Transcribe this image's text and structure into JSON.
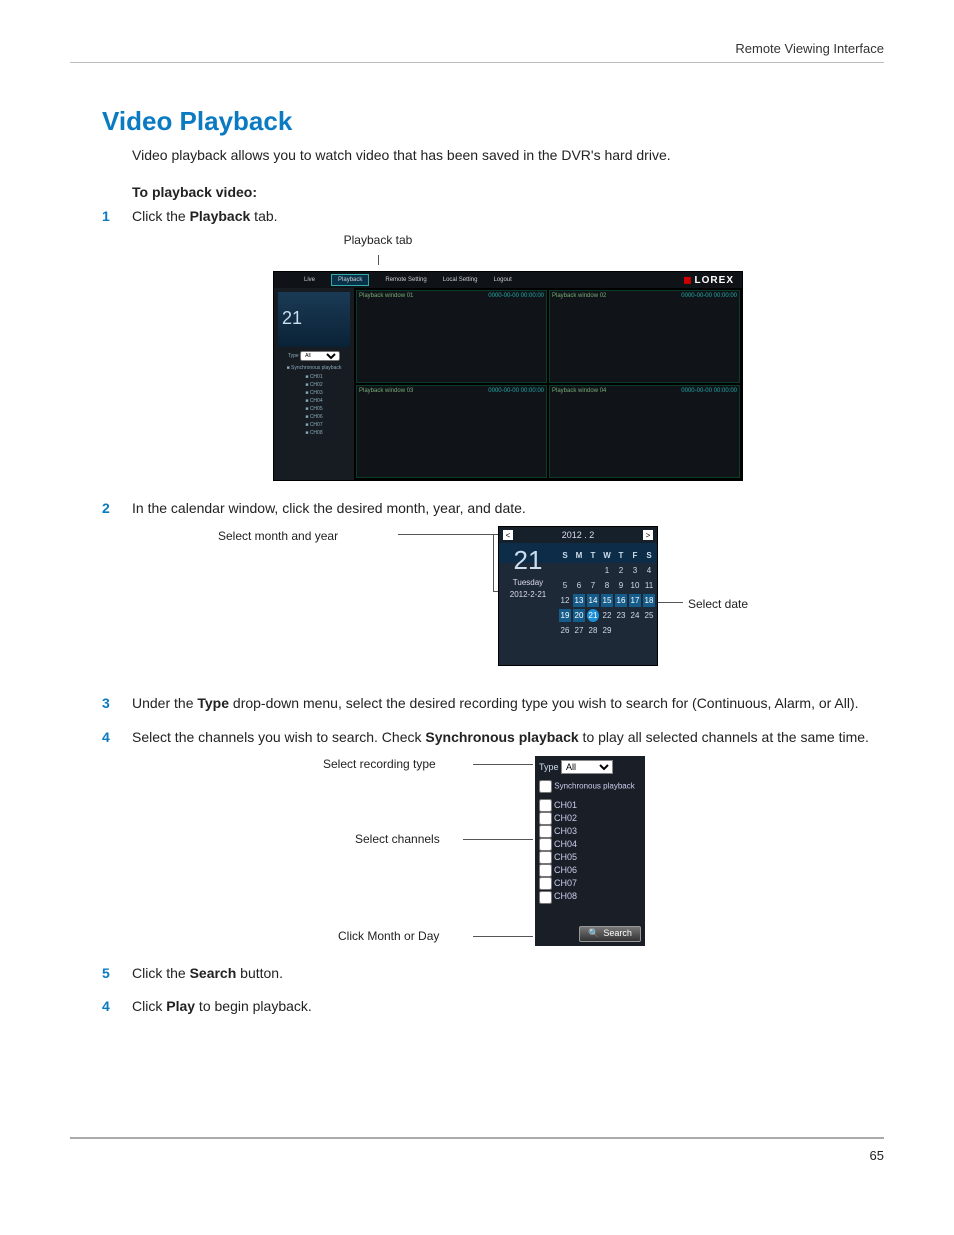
{
  "header": {
    "breadcrumb": "Remote Viewing Interface"
  },
  "title": "Video Playback",
  "intro": "Video playback allows you to watch video that has been saved in the DVR's hard drive.",
  "subhead": "To playback video:",
  "steps": {
    "s1": {
      "num": "1",
      "pre": "Click the ",
      "bold": "Playback",
      "post": " tab."
    },
    "s2": {
      "num": "2",
      "text": "In the calendar window, click the desired month, year, and date."
    },
    "s3": {
      "num": "3",
      "pre": "Under the ",
      "bold": "Type",
      "post": " drop-down menu, select the desired recording type you wish to search for (Continuous, Alarm, or All)."
    },
    "s4": {
      "num": "4",
      "pre": "Select the channels you wish to search. Check ",
      "bold": "Synchronous playback",
      "post": " to play all selected channels at the same time."
    },
    "s5": {
      "num": "5",
      "pre": "Click the ",
      "bold": "Search",
      "post": " button."
    },
    "s6": {
      "num": "4",
      "pre": "Click ",
      "bold": "Play",
      "post": " to begin playback."
    }
  },
  "fig1": {
    "caption": "Playback tab",
    "tabs": [
      "Live",
      "Playback",
      "Remote Setting",
      "Local Setting",
      "Logout"
    ],
    "logo": "LOREX",
    "side_bignum": "21",
    "side_type_label": "Type",
    "side_type_value": "All",
    "side_sync": "Synchronous playback",
    "side_channels": [
      "CH01",
      "CH02",
      "CH03",
      "CH04",
      "CH05",
      "CH06",
      "CH07",
      "CH08"
    ],
    "cells": [
      {
        "l": "Playback window 01",
        "r": "0000-00-00 00:00:00"
      },
      {
        "l": "Playback window 02",
        "r": "0000-00-00 00:00:00"
      },
      {
        "l": "Playback window 03",
        "r": "0000-00-00 00:00:00"
      },
      {
        "l": "Playback window 04",
        "r": "0000-00-00 00:00:00"
      }
    ]
  },
  "fig2": {
    "label_left": "Select month and year",
    "label_right": "Select date",
    "top_month": "2012 . 2",
    "bignum": "21",
    "dayname": "Tuesday",
    "datestr": "2012-2-21",
    "dows": [
      "S",
      "M",
      "T",
      "W",
      "T",
      "F",
      "S"
    ],
    "rows": [
      [
        "",
        "",
        "",
        "1",
        "2",
        "3",
        "4"
      ],
      [
        "5",
        "6",
        "7",
        "8",
        "9",
        "10",
        "11"
      ],
      [
        "12",
        "13",
        "14",
        "15",
        "16",
        "17",
        "18"
      ],
      [
        "19",
        "20",
        "21",
        "22",
        "23",
        "24",
        "25"
      ],
      [
        "26",
        "27",
        "28",
        "29",
        "",
        "",
        ""
      ]
    ],
    "highlighted": [
      "13",
      "14",
      "15",
      "16",
      "17",
      "18",
      "19",
      "20"
    ],
    "selected": "21"
  },
  "fig3": {
    "label_type": "Select recording type",
    "label_channels": "Select channels",
    "label_search": "Click Month or Day",
    "type_label": "Type",
    "type_value": "All",
    "sync_label": "Synchronous playback",
    "channels": [
      "CH01",
      "CH02",
      "CH03",
      "CH04",
      "CH05",
      "CH06",
      "CH07",
      "CH08"
    ],
    "search_btn": "Search"
  },
  "pagenum": "65"
}
